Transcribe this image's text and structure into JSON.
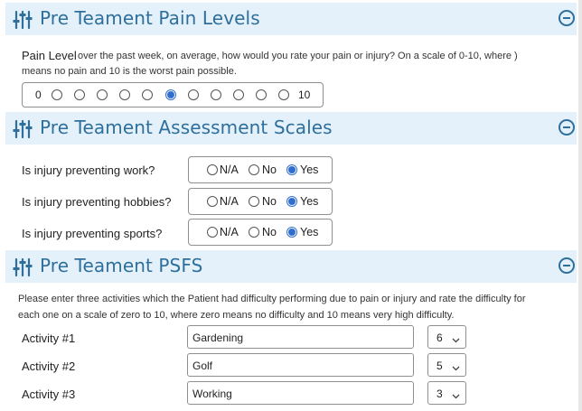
{
  "colors": {
    "accent": "#2e6f9c",
    "header_bg": "#e4f1fa",
    "radio_selected": "#2f6ed0"
  },
  "sections": {
    "pain": {
      "title": "Pre Teament Pain Levels",
      "icon": "sliders-icon"
    },
    "assessment": {
      "title": "Pre Teament Assessment Scales",
      "icon": "sliders-icon"
    },
    "psfs": {
      "title": "Pre Teament PSFS",
      "icon": "sliders-icon"
    }
  },
  "pain_question": {
    "label": "Pain Level",
    "text_line1": "over the past week, on average, how would you rate your pain or injury? On a scale of 0-10, where )",
    "text_line2": "means no pain and 10 is the worst pain possible.",
    "scale_min": "0",
    "scale_max": "10",
    "selected_index": 5,
    "option_count": 11
  },
  "assessment_questions": [
    {
      "label": "Is injury preventing work?",
      "options": [
        "N/A",
        "No",
        "Yes"
      ],
      "selected": "Yes"
    },
    {
      "label": "Is injury preventing hobbies?",
      "options": [
        "N/A",
        "No",
        "Yes"
      ],
      "selected": "Yes"
    },
    {
      "label": "Is injury preventing sports?",
      "options": [
        "N/A",
        "No",
        "Yes"
      ],
      "selected": "Yes"
    }
  ],
  "psfs": {
    "instructions_line1": "Please enter three activities which the Patient had difficulty performing due to pain or injury and rate the difficulty for",
    "instructions_line2": "each one on a scale of zero to 10, where zero means no difficulty and 10 means very high difficulty.",
    "activities": [
      {
        "label": "Activity #1",
        "value": "Gardening",
        "score": "6"
      },
      {
        "label": "Activity #2",
        "value": "Golf",
        "score": "5"
      },
      {
        "label": "Activity #3",
        "value": "Working",
        "score": "3"
      }
    ]
  }
}
